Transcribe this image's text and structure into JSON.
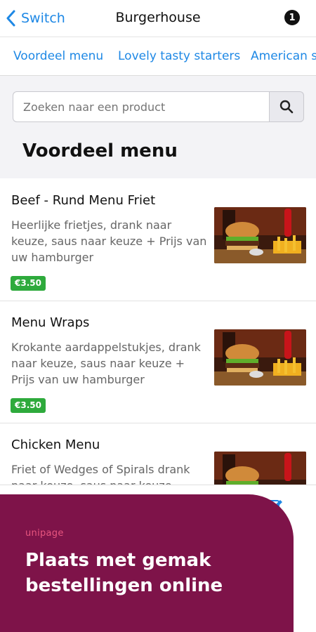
{
  "header": {
    "back_label": "Switch",
    "title": "Burgerhouse",
    "badge_count": "1"
  },
  "tabs": [
    "Voordeel menu",
    "Lovely tasty starters",
    "American s"
  ],
  "search": {
    "placeholder": "Zoeken naar een product"
  },
  "section": {
    "title": "Voordeel menu"
  },
  "items": [
    {
      "name": "Beef - Rund Menu Friet",
      "description": "Heerlijke frietjes, drank naar keuze, saus naar keuze + Prijs van uw hamburger",
      "price": "€3.50"
    },
    {
      "name": "Menu Wraps",
      "description": "Krokante aardappelstukjes, drank naar keuze, saus naar keuze + Prijs van uw hamburger",
      "price": "€3.50"
    },
    {
      "name": "Chicken Menu",
      "description": "Friet of Wedges of Spirals drank naar keuze, saus naar keuze",
      "price": ""
    }
  ],
  "promo": {
    "logo": "unipage",
    "line1": "Plaats met gemak",
    "line2": "bestellingen online"
  },
  "colors": {
    "accent": "#1e88e5",
    "price_badge": "#2eaa3c",
    "promo_bg": "#7e1349"
  },
  "icons": {
    "back": "chevron-left-icon",
    "search": "magnifier-icon",
    "edit": "pencil-square-icon",
    "thumbnail": "burger-photo"
  }
}
